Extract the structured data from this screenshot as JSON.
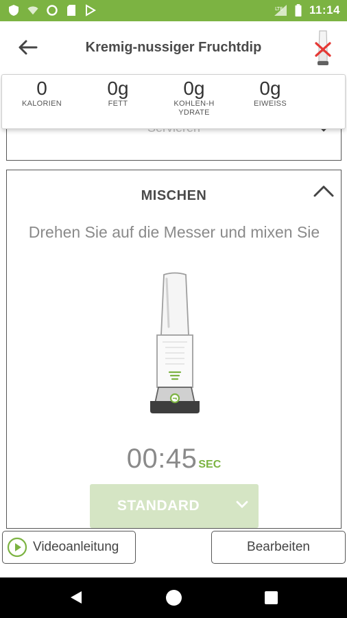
{
  "status_bar": {
    "time": "11:14",
    "icons": [
      "shield-icon",
      "wifi-icon",
      "circle-icon",
      "sd-card-icon",
      "play-store-icon",
      "lte-signal-icon",
      "battery-icon"
    ],
    "lte": "LTE"
  },
  "header": {
    "title": "Kremig-nussiger Fruchtdip",
    "back_icon": "arrow-left-icon",
    "device_icon": "blender-disconnected-icon"
  },
  "nutrition": [
    {
      "value": "0",
      "label": "KALORIEN"
    },
    {
      "value": "0g",
      "label": "FETT"
    },
    {
      "value": "0g",
      "label": "KOHLEN-HYDRATE"
    },
    {
      "value": "0g",
      "label": "EIWEISS"
    }
  ],
  "previous_step": {
    "ghost_text": "Servieren"
  },
  "step": {
    "title": "MISCHEN",
    "description": "Drehen Sie auf die Messer und mixen Sie",
    "timer_value": "00:45",
    "timer_unit": "SEC",
    "mode_label": "STANDARD"
  },
  "footer": {
    "video_label": "Videoanleitung",
    "edit_label": "Bearbeiten"
  },
  "colors": {
    "brand_green": "#7cb342",
    "mode_button_bg": "#d5e5c4",
    "error_red": "#e53935"
  }
}
